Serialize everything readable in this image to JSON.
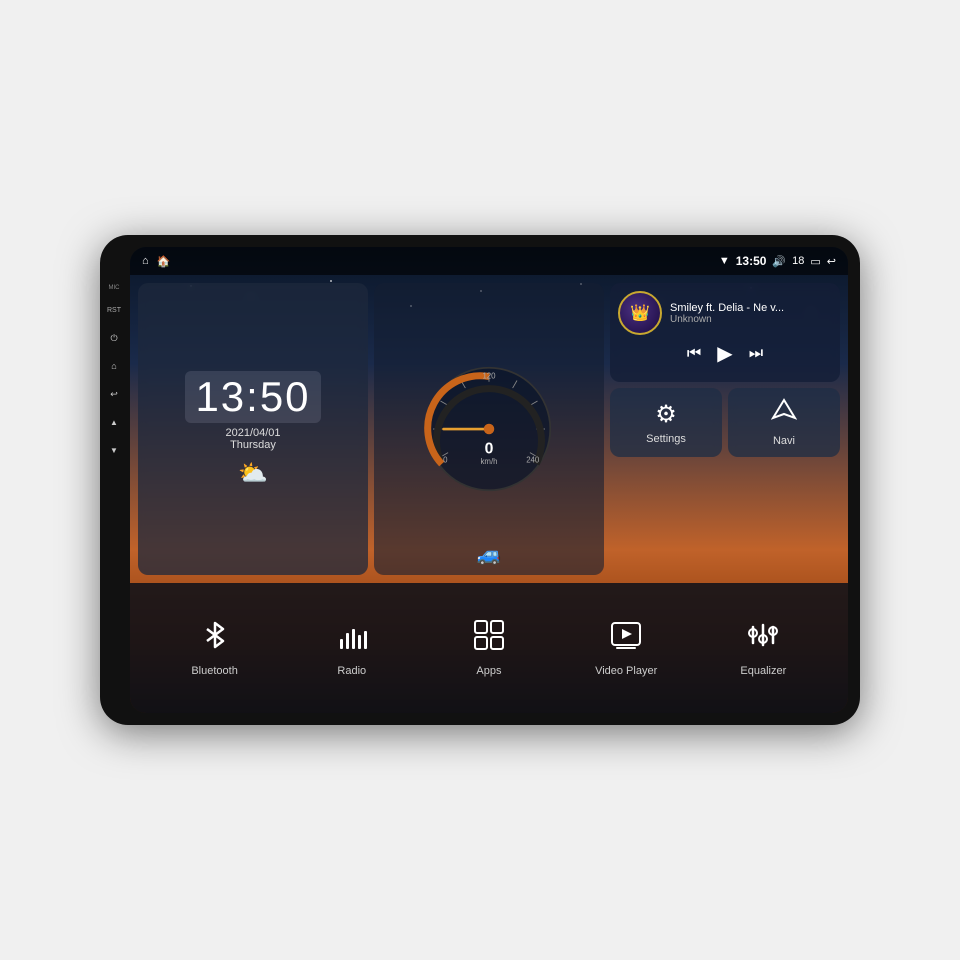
{
  "device": {
    "title": "Car Head Unit"
  },
  "status_bar": {
    "wifi_icon": "▼",
    "time": "13:50",
    "volume_icon": "🔊",
    "volume_level": "18",
    "battery_icon": "🔋",
    "back_icon": "↩",
    "home_icon": "⌂",
    "nav_icon": "🏠"
  },
  "side_buttons": [
    {
      "label": "MIC",
      "icon": "MIC"
    },
    {
      "label": "RST",
      "icon": "RST"
    },
    {
      "label": "",
      "icon": "⏻"
    },
    {
      "label": "",
      "icon": "⌂"
    },
    {
      "label": "",
      "icon": "↩"
    },
    {
      "label": "+",
      "icon": "🔊+"
    },
    {
      "label": "-",
      "icon": "🔊-"
    }
  ],
  "clock": {
    "time": "13:50",
    "date": "2021/04/01",
    "day": "Thursday",
    "weather_icon": "⛅"
  },
  "music": {
    "title": "Smiley ft. Delia - Ne v...",
    "artist": "Unknown",
    "album_icon": "🎵",
    "prev_icon": "⏮",
    "play_icon": "▶",
    "next_icon": "⏭"
  },
  "tiles": [
    {
      "id": "settings",
      "label": "Settings",
      "icon": "⚙"
    },
    {
      "id": "navi",
      "label": "Navi",
      "icon": "◬"
    }
  ],
  "bottom_buttons": [
    {
      "id": "bluetooth",
      "label": "Bluetooth",
      "icon": "bluetooth"
    },
    {
      "id": "radio",
      "label": "Radio",
      "icon": "radio"
    },
    {
      "id": "apps",
      "label": "Apps",
      "icon": "apps"
    },
    {
      "id": "video-player",
      "label": "Video Player",
      "icon": "video"
    },
    {
      "id": "equalizer",
      "label": "Equalizer",
      "icon": "equalizer"
    }
  ]
}
